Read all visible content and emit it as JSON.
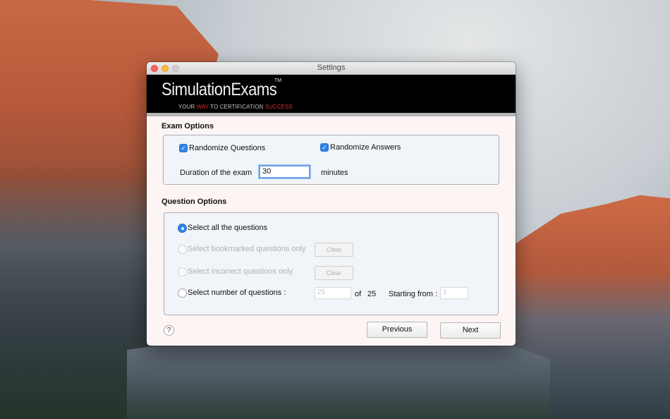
{
  "window": {
    "title": "Settings"
  },
  "banner": {
    "logo_text": "SimulationExams",
    "trademark": "TM",
    "tagline_part1": "YOUR ",
    "tagline_part2": "WAY",
    "tagline_part3": " TO CERTIFICATION ",
    "tagline_part4": "SUCCESS"
  },
  "exam_options": {
    "heading": "Exam Options",
    "randomize_questions": {
      "label": "Randomize Questions",
      "checked": true
    },
    "randomize_answers": {
      "label": "Randomize Answers",
      "checked": true
    },
    "duration_label": "Duration of the exam",
    "duration_value": "30",
    "duration_unit": "minutes"
  },
  "question_options": {
    "heading": "Question Options",
    "select_all": {
      "label": "Select all the questions",
      "selected": true
    },
    "select_bookmarked": {
      "label": "Select bookmarked questions only",
      "clear_label": "Clear",
      "enabled": false
    },
    "select_incorrect": {
      "label": "Select incorrect questions only",
      "clear_label": "Clear",
      "enabled": false
    },
    "select_number": {
      "label": "Select number of questions :",
      "count_value": "25",
      "of_label": "of",
      "total": "25",
      "starting_label": "Starting from :",
      "starting_value": "1"
    }
  },
  "footer": {
    "help_label": "?",
    "previous_label": "Previous",
    "next_label": "Next"
  },
  "colors": {
    "accent": "#2d84e8",
    "banner_bg": "#000000",
    "tagline_accent": "#e02c2c"
  }
}
